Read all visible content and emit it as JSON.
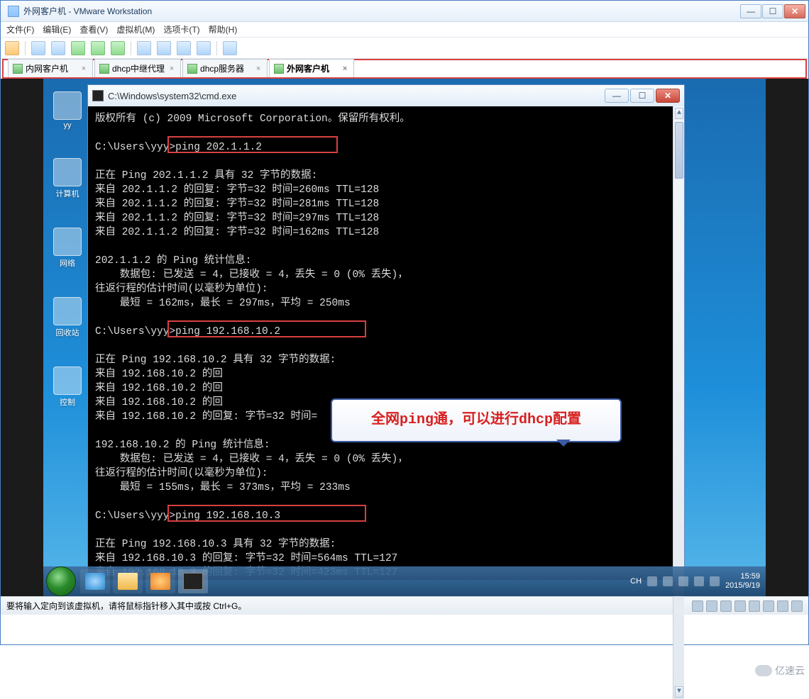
{
  "vmware": {
    "title": "外网客户机 - VMware Workstation",
    "menus": [
      "文件(F)",
      "编辑(E)",
      "查看(V)",
      "虚拟机(M)",
      "选项卡(T)",
      "帮助(H)"
    ],
    "tabs": [
      {
        "label": "内网客户机",
        "active": false
      },
      {
        "label": "dhcp中继代理",
        "active": false
      },
      {
        "label": "dhcp服务器",
        "active": false
      },
      {
        "label": "外网客户机",
        "active": true
      }
    ],
    "status": "要将输入定向到该虚拟机，请将鼠标指针移入其中或按 Ctrl+G。"
  },
  "guest": {
    "desktop_icons": [
      "yy",
      "计算机",
      "网络",
      "回收站",
      "控制"
    ],
    "taskbar": {
      "lang": "CH",
      "time": "15:59",
      "date": "2015/9/19"
    }
  },
  "cmd": {
    "title": "C:\\Windows\\system32\\cmd.exe",
    "lines": [
      "版权所有 (c) 2009 Microsoft Corporation。保留所有权利。",
      "",
      "C:\\Users\\yyy>ping 202.1.1.2",
      "",
      "正在 Ping 202.1.1.2 具有 32 字节的数据:",
      "来自 202.1.1.2 的回复: 字节=32 时间=260ms TTL=128",
      "来自 202.1.1.2 的回复: 字节=32 时间=281ms TTL=128",
      "来自 202.1.1.2 的回复: 字节=32 时间=297ms TTL=128",
      "来自 202.1.1.2 的回复: 字节=32 时间=162ms TTL=128",
      "",
      "202.1.1.2 的 Ping 统计信息:",
      "    数据包: 已发送 = 4，已接收 = 4，丢失 = 0 (0% 丢失)，",
      "往返行程的估计时间(以毫秒为单位):",
      "    最短 = 162ms，最长 = 297ms，平均 = 250ms",
      "",
      "C:\\Users\\yyy>ping 192.168.10.2",
      "",
      "正在 Ping 192.168.10.2 具有 32 字节的数据:",
      "来自 192.168.10.2 的回",
      "来自 192.168.10.2 的回",
      "来自 192.168.10.2 的回",
      "来自 192.168.10.2 的回复: 字节=32 时间=                ",
      "",
      "192.168.10.2 的 Ping 统计信息:",
      "    数据包: 已发送 = 4，已接收 = 4，丢失 = 0 (0% 丢失)，",
      "往返行程的估计时间(以毫秒为单位):",
      "    最短 = 155ms，最长 = 373ms，平均 = 233ms",
      "",
      "C:\\Users\\yyy>ping 192.168.10.3",
      "",
      "正在 Ping 192.168.10.3 具有 32 字节的数据:",
      "来自 192.168.10.3 的回复: 字节=32 时间=564ms TTL=127",
      "来自 192.168.10.3 的回复: 字节=32 时间=423ms TTL=127"
    ]
  },
  "callout": "全网ping通，可以进行dhcp配置",
  "watermark": "亿速云"
}
